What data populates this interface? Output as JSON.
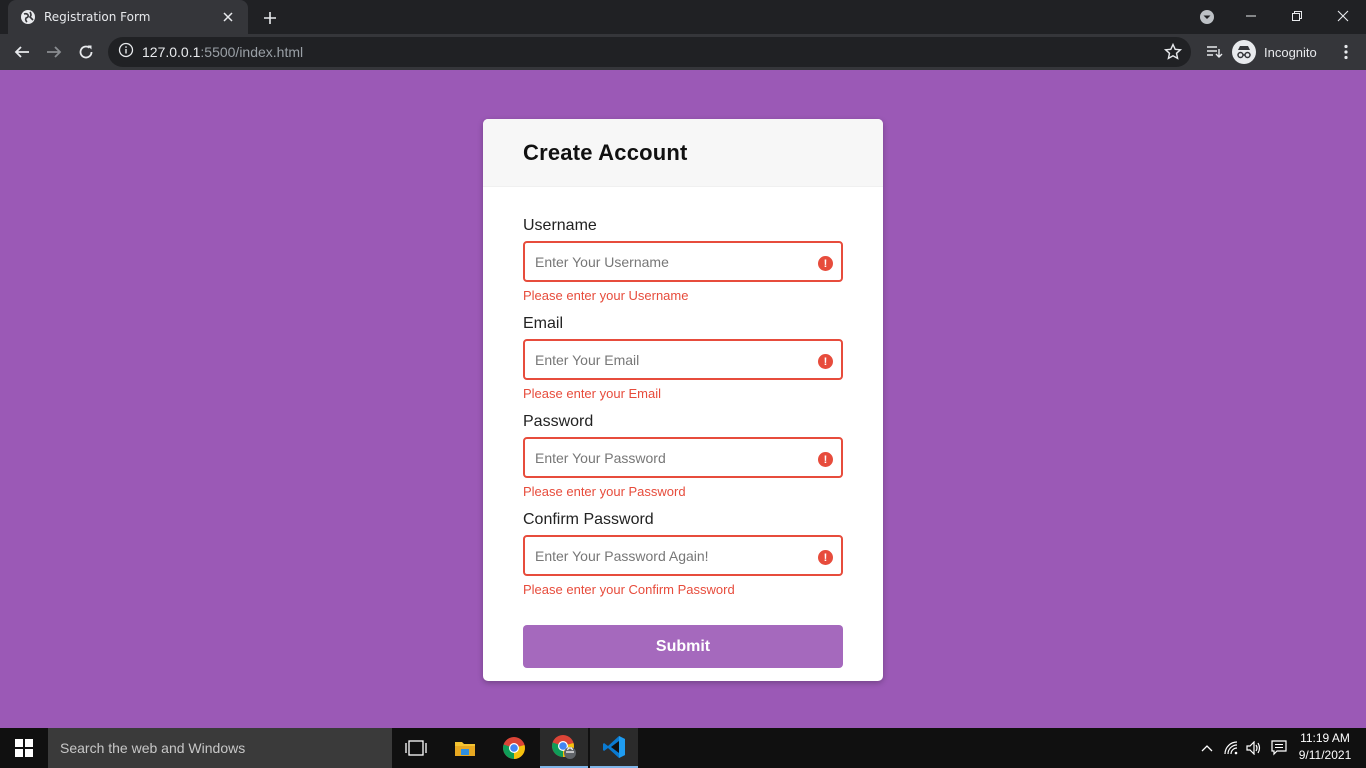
{
  "browser": {
    "tab_title": "Registration Form",
    "url_host": "127.0.0.1",
    "url_rest": ":5500/index.html",
    "profile_label": "Incognito"
  },
  "page": {
    "heading": "Create Account",
    "fields": [
      {
        "label": "Username",
        "placeholder": "Enter Your Username",
        "error": "Please enter your Username"
      },
      {
        "label": "Email",
        "placeholder": "Enter Your Email",
        "error": "Please enter your Email"
      },
      {
        "label": "Password",
        "placeholder": "Enter Your Password",
        "error": "Please enter your Password"
      },
      {
        "label": "Confirm Password",
        "placeholder": "Enter Your Password Again!",
        "error": "Please enter your Confirm Password"
      }
    ],
    "error_glyph": "!",
    "submit_label": "Submit",
    "colors": {
      "background": "#9b59b6",
      "error": "#e74c3c",
      "button": "#a569bd"
    }
  },
  "taskbar": {
    "search_placeholder": "Search the web and Windows",
    "time": "11:19 AM",
    "date": "9/11/2021"
  }
}
